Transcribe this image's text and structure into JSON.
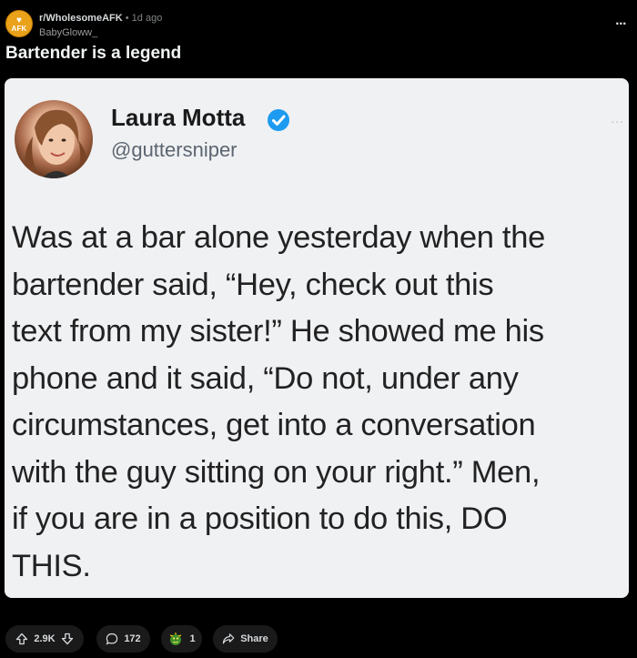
{
  "header": {
    "subreddit": "r/WholesomeAFK",
    "separator": "•",
    "age": "1d ago",
    "author": "BabyGloww_",
    "avatar_text": "AFK",
    "overflow_label": "..."
  },
  "post": {
    "title": "Bartender is a legend"
  },
  "tweet": {
    "name": "Laura Motta",
    "handle": "@guttersniper",
    "more_label": "...",
    "lines": [
      "Was at a bar alone yesterday when the",
      "bartender said, “Hey, check out this",
      "text from my sister!” He showed me his",
      "phone and it said, “Do not, under any",
      "circumstances, get into a conversation",
      "with the guy sitting on your right.” Men,",
      "if you are in a position to do this, DO",
      "THIS."
    ]
  },
  "actions": {
    "votes": "2.9K",
    "comments": "172",
    "awards": "1",
    "share_label": "Share"
  },
  "colors": {
    "background": "#000000",
    "pill": "#1a1a1b",
    "card": "#f0f1f3",
    "verified": "#1d9bf0",
    "subreddit_avatar": "#e9a21a"
  },
  "icons": [
    "afk-avatar-icon",
    "overflow-icon",
    "verified-badge-icon",
    "upvote-icon",
    "downvote-icon",
    "comment-icon",
    "award-icon",
    "share-icon"
  ]
}
